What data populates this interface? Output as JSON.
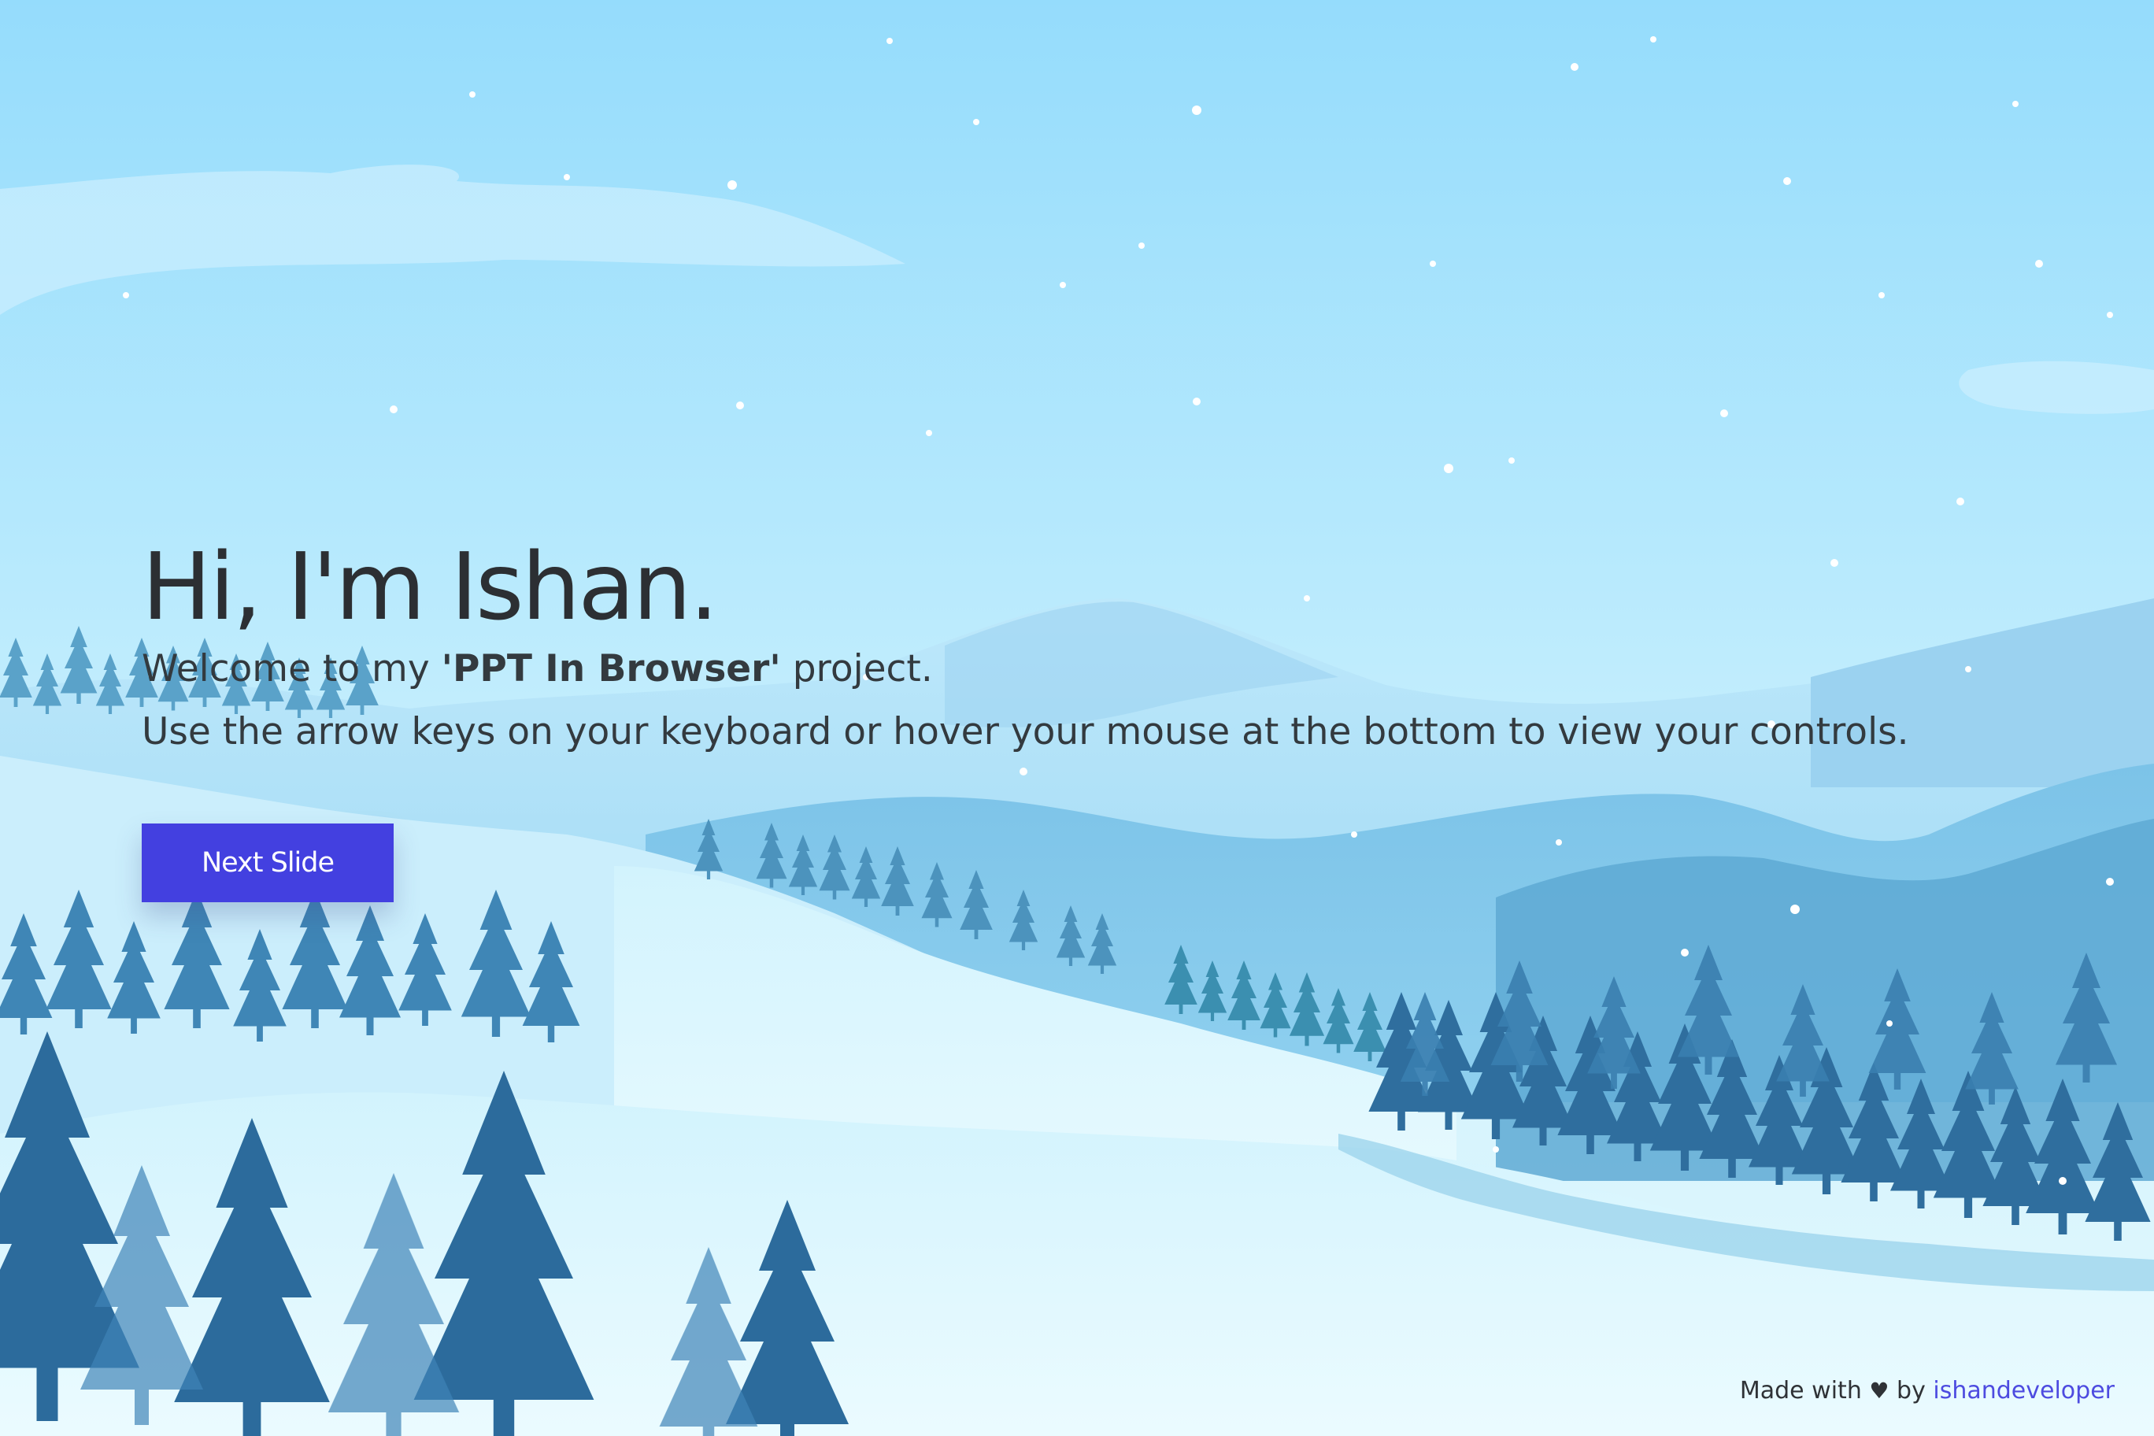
{
  "hero": {
    "title": "Hi, I'm Ishan.",
    "welcome_prefix": "Welcome to my ",
    "project_name": "'PPT In Browser'",
    "welcome_suffix": " project.",
    "instructions": "Use the arrow keys on your keyboard or hover your mouse at the bottom to view your controls."
  },
  "next_button": {
    "label": "Next Slide"
  },
  "footer": {
    "made_with": "Made with",
    "heart": "♥",
    "by": "by",
    "author_link": "ishandeveloper"
  },
  "colors": {
    "accent": "#4340e0",
    "link": "#4d4be0",
    "text": "#2c2f33"
  },
  "background": {
    "icon": "snowy-mountain-landscape-illustration"
  }
}
